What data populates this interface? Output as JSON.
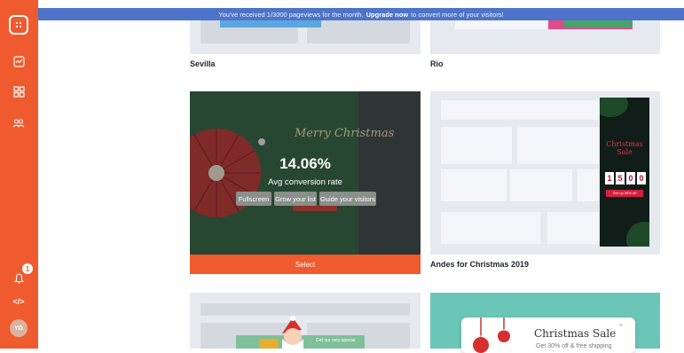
{
  "banner": {
    "prefix": "You've received 1/3000 pageviews for the month.",
    "link": "Upgrade now",
    "suffix": "to convert more of your visitors!"
  },
  "sidebar": {
    "items": [
      {
        "icon": "dashboard-icon"
      },
      {
        "icon": "analytics-icon"
      },
      {
        "icon": "templates-icon"
      },
      {
        "icon": "users-icon"
      }
    ],
    "notification_icon": "bell-icon",
    "notification_count": "1",
    "code_icon": "code-icon",
    "code_label": "</>",
    "avatar_initials": "YD"
  },
  "templates": [
    {
      "title": "Sevilla"
    },
    {
      "title": "Rio"
    },
    {
      "title": "",
      "hover": {
        "stat_value": "14.06%",
        "stat_label": "Avg conversion rate",
        "actions": [
          "Fullscreen",
          "Grow your list",
          "Guide your visitors"
        ],
        "select_label": "Select"
      },
      "preview_heading": "Merry Christmas"
    },
    {
      "title": "Andes for Christmas 2019",
      "preview": {
        "heading": "Christmas Sale",
        "digits": [
          "1",
          "5",
          "0",
          "0"
        ],
        "cta": "Get up 30% off"
      }
    },
    {
      "title": "",
      "preview_cta": "Get our very special"
    },
    {
      "title": "",
      "preview": {
        "heading": "Christmas Sale",
        "subtext": "Get 30% off & free shipping"
      }
    }
  ],
  "colors": {
    "accent": "#ef5a2e",
    "banner": "#4d74c9",
    "thumb": "#e6eaef",
    "teal": "#6cc6b8"
  }
}
